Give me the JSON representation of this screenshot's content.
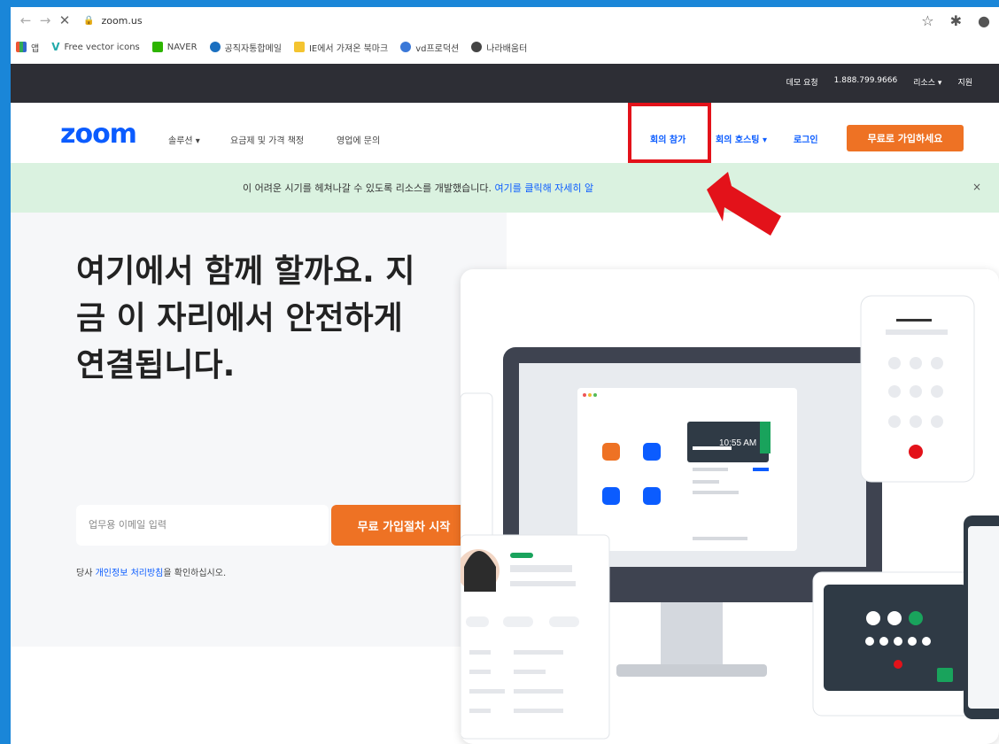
{
  "browser": {
    "url": "zoom.us",
    "bookmarks": [
      "앱",
      "Free vector icons",
      "NAVER",
      "공직자통합메일",
      "IE에서 가져온 북마크",
      "vd프로덕션",
      "나라배움터"
    ]
  },
  "zoom": {
    "topstrip": [
      "데모 요청",
      "1.888.799.9666",
      "리소스 ▾",
      "지원"
    ],
    "logo": "zoom",
    "nav_left": [
      "솔루션 ▾",
      "요금제 및 가격 책정",
      "영업에 문의"
    ],
    "nav_right": [
      "회의 참가",
      "회의 호스팅 ▾",
      "로그인"
    ],
    "signup": "무료로 가입하세요",
    "banner": {
      "text": "이 어려운 시기를 헤쳐나갈 수 있도록 리소스를 개발했습니다. ",
      "link": "여기를 클릭해 자세히 알",
      "close": "×"
    },
    "hero": {
      "title": "여기에서 함께 할까요. 지금 이 자리에서 안전하게 연결됩니다.",
      "email_placeholder": "업무용 이메일 입력",
      "start_button": "무료 가입절차 시작",
      "privacy_prefix": "당사 ",
      "privacy_link": "개인정보 처리방침",
      "privacy_suffix": "을 확인하십시오."
    },
    "illustration": {
      "time": "10:55 AM"
    }
  },
  "colors": {
    "zoom_blue": "#0b5cff",
    "orange": "#ee7224",
    "highlight_red": "#e3121a",
    "banner_green": "#daf2e0",
    "dark_strip": "#2d2e35"
  }
}
